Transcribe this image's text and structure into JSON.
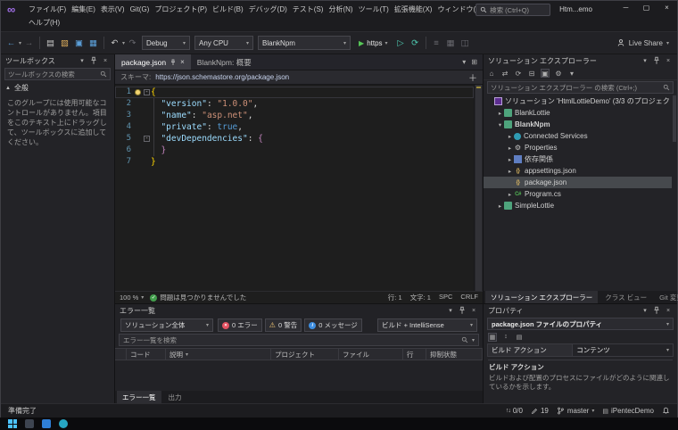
{
  "titlebar": {
    "menus": [
      "ファイル(F)",
      "編集(E)",
      "表示(V)",
      "Git(G)",
      "プロジェクト(P)",
      "ビルド(B)",
      "デバッグ(D)",
      "テスト(S)",
      "分析(N)",
      "ツール(T)",
      "拡張機能(X)",
      "ウィンドウ(W)"
    ],
    "menus_row2": [
      "ヘルプ(H)"
    ],
    "search_placeholder": "検索 (Ctrl+Q)",
    "window_title": "Htm...emo"
  },
  "toolbar": {
    "config": "Debug",
    "platform": "Any CPU",
    "project": "BlankNpm",
    "run_label": "https",
    "live_share": "Live Share"
  },
  "toolbox": {
    "title": "ツールボックス",
    "search_placeholder": "ツールボックスの検索",
    "group_label": "全般",
    "empty_text": "このグループには使用可能なコントロールがありません。項目をこのテキスト上にドラッグして、ツールボックスに追加してください。"
  },
  "editor": {
    "tabs": [
      {
        "label": "package.json",
        "active": true
      },
      {
        "label": "BlankNpm: 概要",
        "active": false
      }
    ],
    "schema_label": "スキーマ:",
    "schema_url": "https://json.schemastore.org/package.json",
    "code_lines": [
      {
        "num": "1",
        "fold": true,
        "bulb": true,
        "current": true,
        "tokens": [
          [
            "brace1",
            "{"
          ]
        ]
      },
      {
        "num": "2",
        "guide": true,
        "tokens": [
          [
            "plain",
            "  "
          ],
          [
            "key",
            "\"version\""
          ],
          [
            "plain",
            ": "
          ],
          [
            "str",
            "\"1.0.0\""
          ],
          [
            "plain",
            ","
          ]
        ]
      },
      {
        "num": "3",
        "guide": true,
        "tokens": [
          [
            "plain",
            "  "
          ],
          [
            "key",
            "\"name\""
          ],
          [
            "plain",
            ": "
          ],
          [
            "str",
            "\"asp.net\""
          ],
          [
            "plain",
            ","
          ]
        ]
      },
      {
        "num": "4",
        "guide": true,
        "tokens": [
          [
            "plain",
            "  "
          ],
          [
            "key",
            "\"private\""
          ],
          [
            "plain",
            ": "
          ],
          [
            "kw",
            "true"
          ],
          [
            "plain",
            ","
          ]
        ]
      },
      {
        "num": "5",
        "guide": true,
        "fold": true,
        "tokens": [
          [
            "plain",
            "  "
          ],
          [
            "key",
            "\"devDependencies\""
          ],
          [
            "plain",
            ": "
          ],
          [
            "brace2",
            "{"
          ]
        ]
      },
      {
        "num": "6",
        "guide": true,
        "tokens": [
          [
            "plain",
            "  "
          ],
          [
            "brace2",
            "}"
          ]
        ]
      },
      {
        "num": "7",
        "tokens": [
          [
            "brace1",
            "}"
          ]
        ]
      }
    ],
    "status": {
      "zoom": "100 %",
      "health": "問題は見つかりませんでした",
      "line": "行: 1",
      "col": "文字: 1",
      "spc": "SPC",
      "eol": "CRLF"
    }
  },
  "error_list": {
    "title": "エラー一覧",
    "scope": "ソリューション全体",
    "errors": "0 エラー",
    "warnings": "0 警告",
    "messages": "0 メッセージ",
    "filter": "ビルド + IntelliSense",
    "search_placeholder": "エラー一覧を検索",
    "columns": [
      "コード",
      "説明",
      "プロジェクト",
      "ファイル",
      "行",
      "抑制状態"
    ],
    "tabs": [
      {
        "label": "エラー一覧",
        "active": true
      },
      {
        "label": "出力",
        "active": false
      }
    ]
  },
  "solution_explorer": {
    "title": "ソリューション エクスプローラー",
    "search_placeholder": "ソリューション エクスプローラー の検索 (Ctrl+;)",
    "tree": [
      {
        "indent": 0,
        "caret": "",
        "icon": "solution",
        "label": "ソリューション 'HtmlLottieDemo' (3/3 のプロジェクト)"
      },
      {
        "indent": 1,
        "caret": "right",
        "icon": "project",
        "label": "BlankLottie"
      },
      {
        "indent": 1,
        "caret": "down",
        "icon": "project",
        "label": "BlankNpm",
        "bold": true
      },
      {
        "indent": 2,
        "caret": "right",
        "icon": "services",
        "label": "Connected Services"
      },
      {
        "indent": 2,
        "caret": "right",
        "icon": "props",
        "label": "Properties"
      },
      {
        "indent": 2,
        "caret": "right",
        "icon": "deps",
        "label": "依存関係"
      },
      {
        "indent": 2,
        "caret": "right",
        "icon": "json",
        "label": "appsettings.json"
      },
      {
        "indent": 2,
        "caret": "",
        "icon": "json",
        "label": "package.json",
        "selected": true
      },
      {
        "indent": 2,
        "caret": "right",
        "icon": "cs",
        "label": "Program.cs"
      },
      {
        "indent": 1,
        "caret": "right",
        "icon": "project",
        "label": "SimpleLottie"
      }
    ],
    "tabs": [
      {
        "label": "ソリューション エクスプローラー",
        "active": true
      },
      {
        "label": "クラス ビュー",
        "active": false
      },
      {
        "label": "Git 変更",
        "active": false
      }
    ]
  },
  "properties": {
    "title": "プロパティ",
    "object": "package.json ファイルのプロパティ",
    "grid": {
      "label": "ビルド アクション",
      "value": "コンテンツ"
    },
    "desc_title": "ビルド アクション",
    "desc_text": "ビルドおよび配置のプロセスにファイルがどのように関連しているかを示します。"
  },
  "status_bar": {
    "ready": "準備完了",
    "sync": "0/0",
    "changes": "19",
    "branch": "master",
    "repo": "iPentecDemo"
  },
  "colors": {
    "accent": "#007acc",
    "error": "#e35161",
    "warning": "#f0c674",
    "info": "#3e8ee0",
    "ok": "#429e4c"
  }
}
